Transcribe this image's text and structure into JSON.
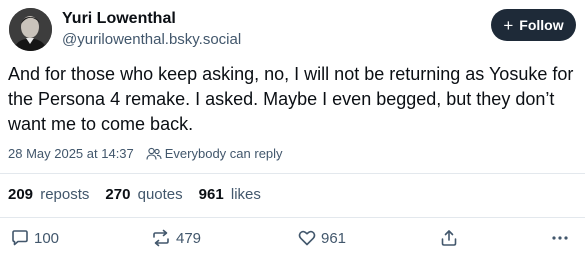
{
  "author": {
    "name": "Yuri Lowenthal",
    "handle": "@yurilowenthal.bsky.social",
    "avatar_icon": "avatar-photo"
  },
  "follow_button": {
    "label": "Follow",
    "icon": "plus-icon"
  },
  "post": {
    "text": "And for those who keep asking, no, I will not be returning as Yosuke for the Persona 4 remake. I asked. Maybe I even begged, but they don’t want me to come back.",
    "timestamp": "28 May 2025 at 14:37",
    "reply_setting": "Everybody can reply"
  },
  "stats": {
    "reposts_count": "209",
    "reposts_label": "reposts",
    "quotes_count": "270",
    "quotes_label": "quotes",
    "likes_count": "961",
    "likes_label": "likes"
  },
  "actions": {
    "replies": "100",
    "reposts": "479",
    "likes": "961"
  },
  "colors": {
    "follow_bg": "#1e2a38",
    "muted_text": "#42576c",
    "divider": "#e3e8ed"
  }
}
